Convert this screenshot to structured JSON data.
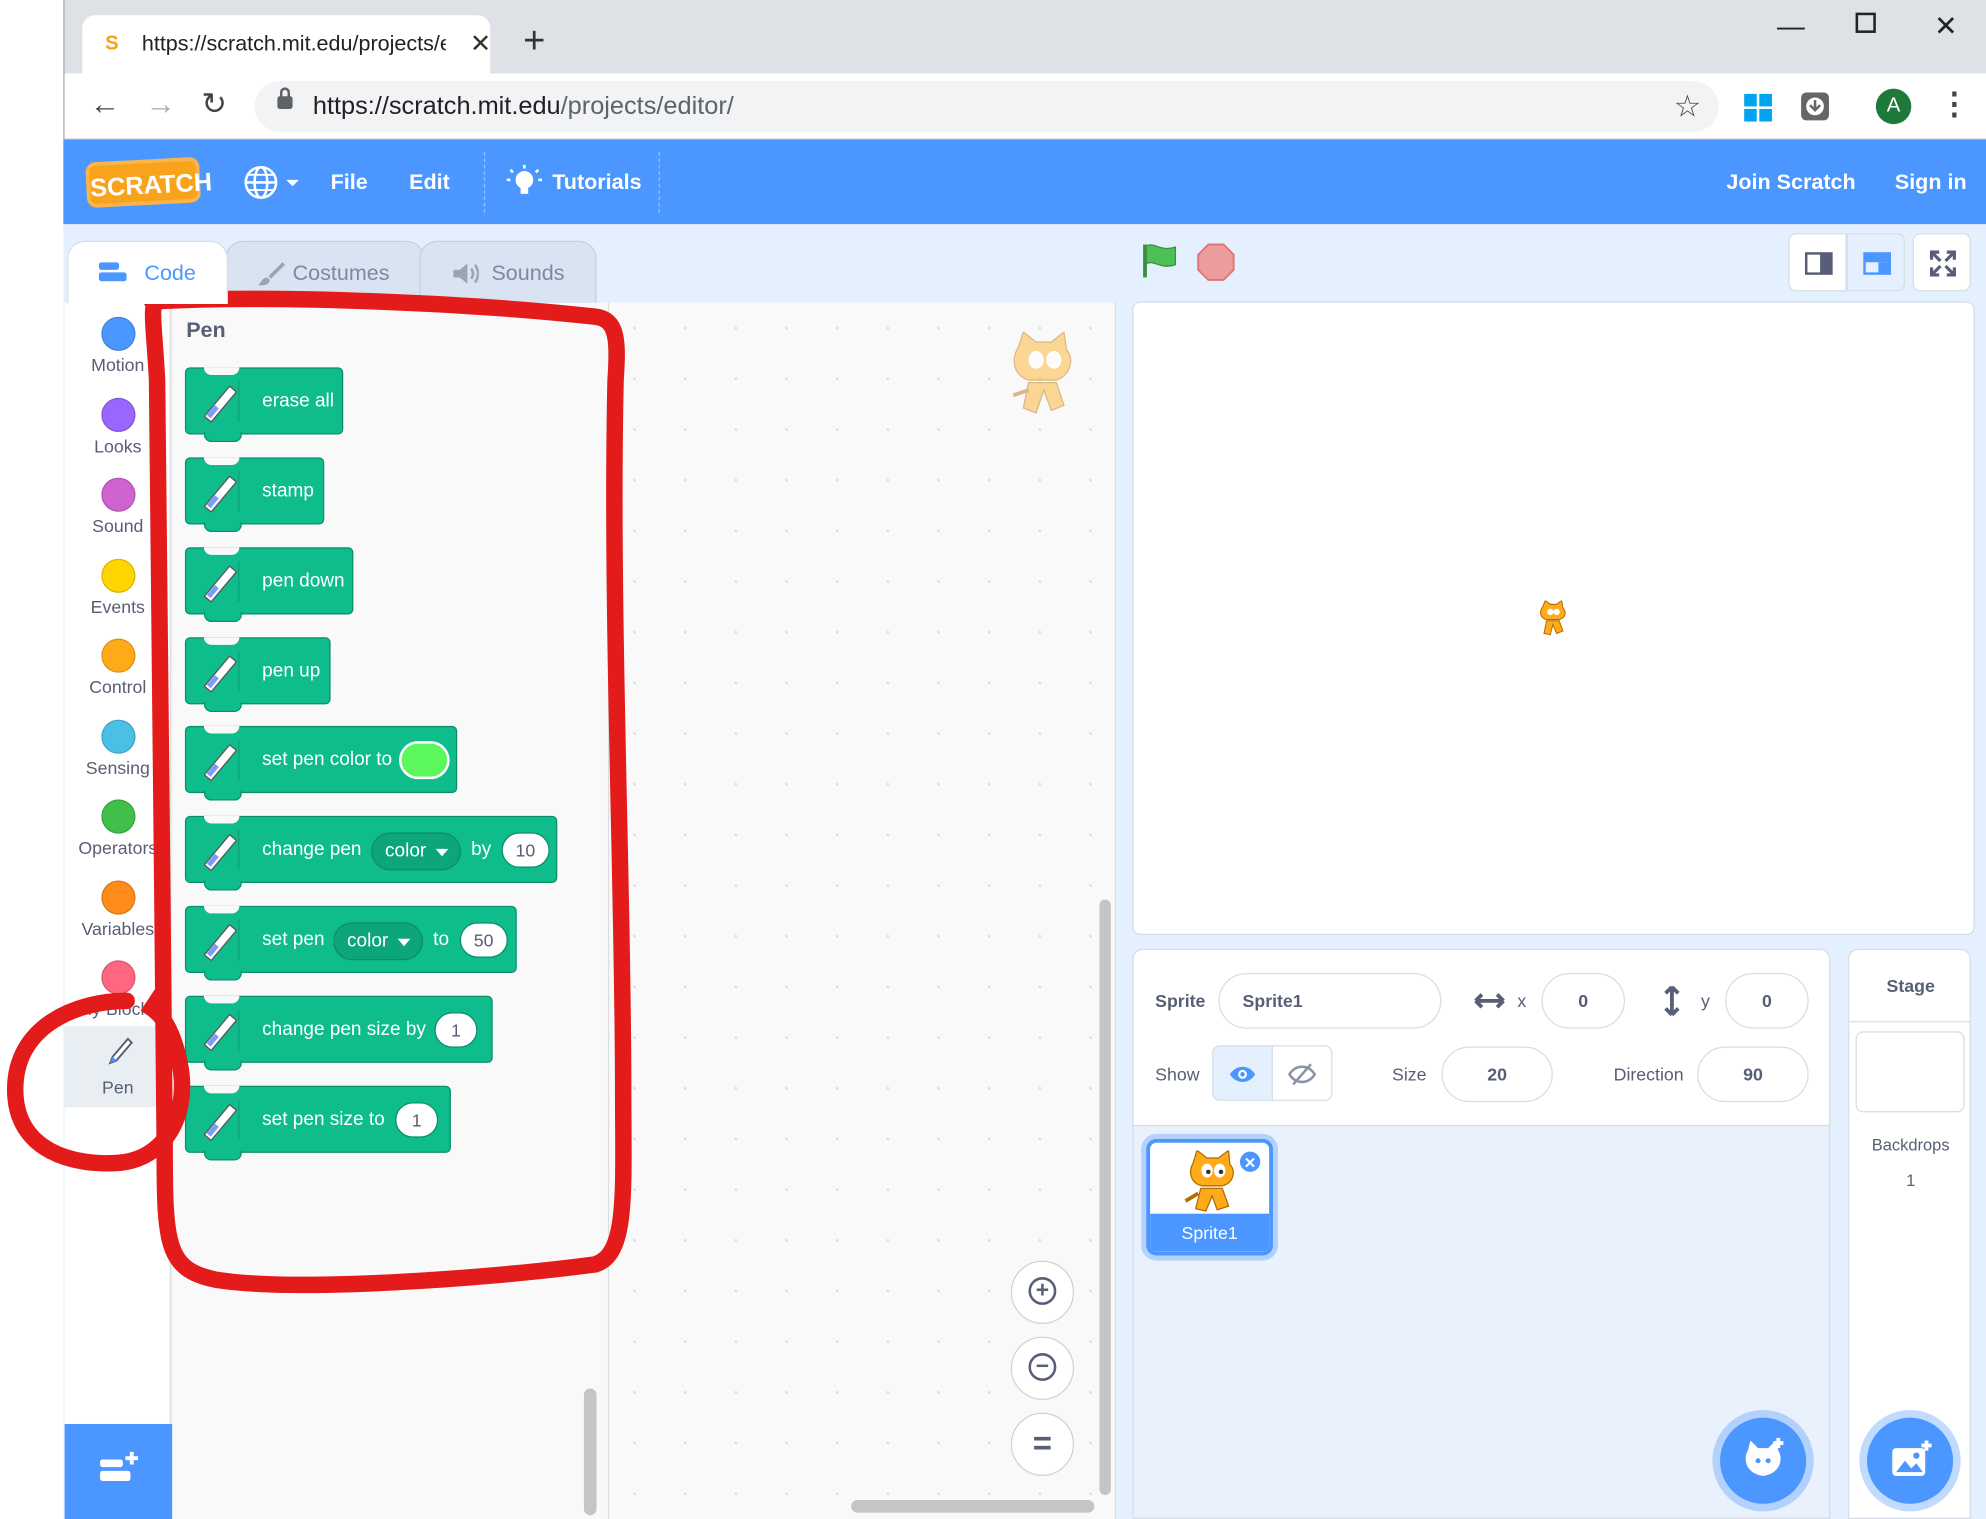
{
  "browser": {
    "tab_title": "https://scratch.mit.edu/projects/e",
    "favicon": "S",
    "url_host": "https://scratch.mit.edu",
    "url_path": "/projects/editor/",
    "profile_initial": "A"
  },
  "menubar": {
    "logo": "SCRATCH",
    "file": "File",
    "edit": "Edit",
    "tutorials": "Tutorials",
    "join": "Join Scratch",
    "signin": "Sign in"
  },
  "editor_tabs": {
    "code": "Code",
    "costumes": "Costumes",
    "sounds": "Sounds"
  },
  "categories": [
    {
      "name": "Motion",
      "color": "#4c97ff"
    },
    {
      "name": "Looks",
      "color": "#9966ff"
    },
    {
      "name": "Sound",
      "color": "#cf63cf"
    },
    {
      "name": "Events",
      "color": "#ffd500"
    },
    {
      "name": "Control",
      "color": "#ffab19"
    },
    {
      "name": "Sensing",
      "color": "#4cbfe6"
    },
    {
      "name": "Operators",
      "color": "#40bf4a"
    },
    {
      "name": "Variables",
      "color": "#ff8c1a"
    },
    {
      "name": "My Blocks",
      "color": "#ff6680"
    },
    {
      "name": "Pen",
      "color": "#0fbd8c"
    }
  ],
  "flyout": {
    "title": "Pen",
    "blocks": {
      "erase_all": "erase all",
      "stamp": "stamp",
      "pen_down": "pen down",
      "pen_up": "pen up",
      "set_color": "set pen color to",
      "change_pen": "change pen",
      "change_pen_dropdown": "color",
      "change_pen_by": "by",
      "change_pen_value": "10",
      "set_pen": "set pen",
      "set_pen_dropdown": "color",
      "set_pen_to": "to",
      "set_pen_value": "50",
      "change_size": "change pen size by",
      "change_size_value": "1",
      "set_size": "set pen size to",
      "set_size_value": "1"
    },
    "pen_color": "#5cf75c"
  },
  "sprite_info": {
    "sprite_label": "Sprite",
    "sprite_name": "Sprite1",
    "x_label": "x",
    "x_value": "0",
    "y_label": "y",
    "y_value": "0",
    "show_label": "Show",
    "size_label": "Size",
    "size_value": "20",
    "direction_label": "Direction",
    "direction_value": "90"
  },
  "sprite_list": [
    {
      "name": "Sprite1"
    }
  ],
  "stage_pane": {
    "title": "Stage",
    "backdrops_label": "Backdrops",
    "backdrops_count": "1"
  },
  "colors": {
    "scratch_blue": "#4c97ff",
    "pen_green": "#0fbd8c",
    "annotation_red": "#e31b1b"
  }
}
